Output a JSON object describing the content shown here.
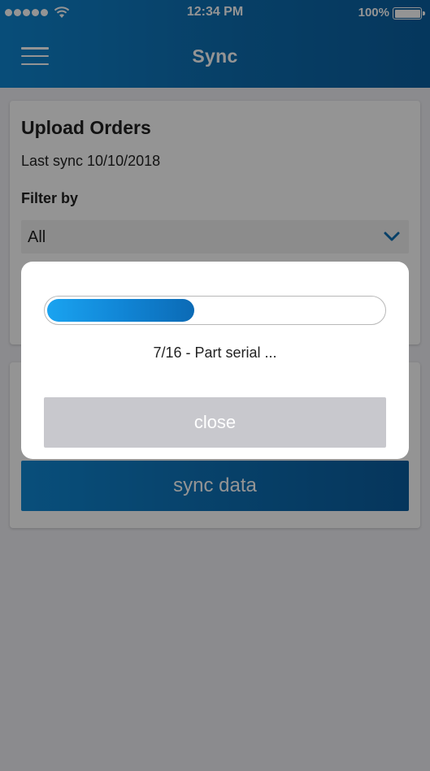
{
  "status_bar": {
    "time": "12:34 PM",
    "battery": "100%",
    "signal_icon": "signal-dots-icon",
    "wifi_icon": "wifi-icon",
    "battery_icon": "battery-icon"
  },
  "header": {
    "title": "Sync",
    "menu_icon": "hamburger-menu-icon"
  },
  "upload_card": {
    "title": "Upload Orders",
    "last_sync": "Last sync 10/10/2018",
    "filter_label": "Filter by",
    "filter_value": "All",
    "dropdown_icon": "chevron-down-icon"
  },
  "sync_card": {
    "sync_button": "sync data"
  },
  "dialog": {
    "progress": 0.4375,
    "progress_text": "7/16 - Part serial ...",
    "close_label": "close"
  },
  "colors": {
    "brand": "#0d6fb4",
    "progress": "#1186d6",
    "disabled_button": "#c8c8cd"
  }
}
